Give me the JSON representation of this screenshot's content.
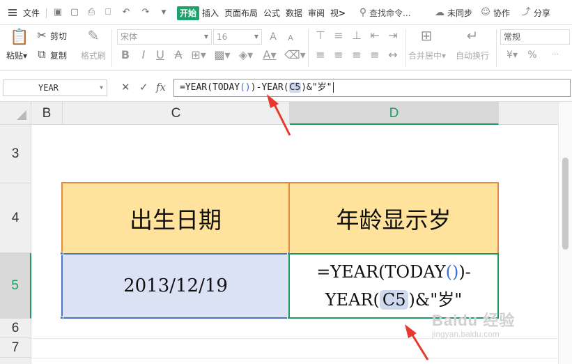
{
  "menubar": {
    "file": "文件",
    "tabs": [
      "开始",
      "插入",
      "页面布局",
      "公式",
      "数据",
      "审阅",
      "视"
    ],
    "more": ">",
    "search": "查找命令...",
    "sync": "未同步",
    "collab": "协作",
    "share": "分享"
  },
  "toolbar": {
    "paste": "粘贴",
    "cut": "剪切",
    "copy": "复制",
    "format_painter": "格式刷",
    "font_name": "宋体",
    "font_size": "16",
    "merge_center": "合并居中",
    "wrap_text": "自动换行",
    "number_format": "常规",
    "currency_symbol": "¥",
    "percent_symbol": "%"
  },
  "formula_bar": {
    "name_box": "YEAR",
    "fx_label": "fx",
    "formula_part1": "=YEAR(TODAY",
    "formula_paren_open": "(",
    "formula_paren_close": ")",
    "formula_part2": ")-YEAR(",
    "formula_ref": "C5",
    "formula_part3": ")&\"岁\""
  },
  "sheet": {
    "columns": [
      "B",
      "C",
      "D"
    ],
    "selected_column": "D",
    "rows": [
      "3",
      "4",
      "5",
      "6",
      "7"
    ],
    "selected_row": "5",
    "header_birth": "出生日期",
    "header_age": "年龄显示岁",
    "birth_date": "2013/12/19",
    "edit_line1_a": "=YEAR(TODAY",
    "edit_line1_po": "(",
    "edit_line1_pc": ")",
    "edit_line1_b": ")-",
    "edit_line2_a": "YEAR(",
    "edit_line2_ref": "C5",
    "edit_line2_b": ")&\"岁\""
  },
  "watermark": {
    "brand": "Baidu 经验",
    "url": "jingyan.baidu.com"
  }
}
